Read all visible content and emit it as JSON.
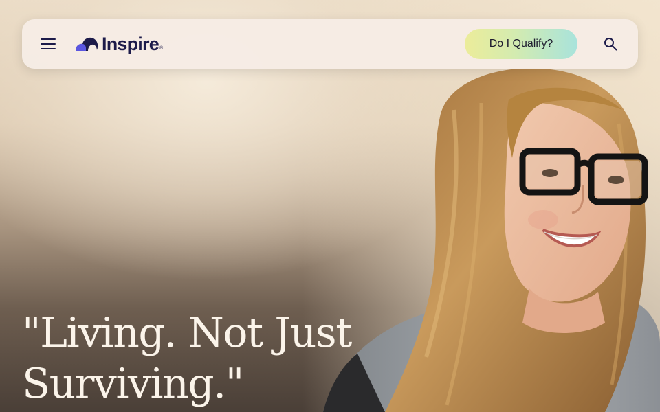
{
  "nav": {
    "menu_icon": "hamburger-menu-icon",
    "logo": {
      "text": "Inspire",
      "mark_icon": "cloud-logo-icon",
      "mark_color": "#5b56e0"
    },
    "cta_label": "Do I Qualify?",
    "search_icon": "search-icon"
  },
  "hero": {
    "headline_line1": "\"Living. Not Just",
    "headline_line2": "Surviving.\"",
    "photo": "portrait-woman-with-glasses"
  },
  "colors": {
    "brand_navy": "#1d1b4a",
    "brand_purple": "#5b56e0",
    "cta_gradient_start": "#ecec9a",
    "cta_gradient_end": "#a8e3dc",
    "headline_text": "#fbf4ea"
  }
}
